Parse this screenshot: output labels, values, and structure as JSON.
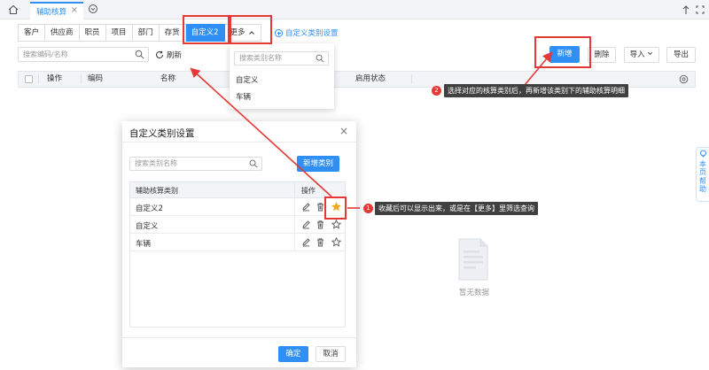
{
  "page_tab": {
    "label": "辅助核算"
  },
  "category_tabs": [
    {
      "label": "客户",
      "active": false
    },
    {
      "label": "供应商",
      "active": false
    },
    {
      "label": "职员",
      "active": false
    },
    {
      "label": "项目",
      "active": false
    },
    {
      "label": "部门",
      "active": false
    },
    {
      "label": "存货",
      "active": false
    },
    {
      "label": "自定义2",
      "active": true
    }
  ],
  "more_tab": {
    "label": "更多"
  },
  "custom_category_link": "自定义类别设置",
  "search": {
    "placeholder": "搜索编码/名称"
  },
  "refresh_label": "刷新",
  "toolbar": {
    "new": "新增",
    "delete": "删除",
    "import": "导入",
    "export": "导出"
  },
  "table": {
    "columns": [
      "操作",
      "编码",
      "名称",
      "启用状态"
    ]
  },
  "empty_text": "暂无数据",
  "help_tab": [
    "本",
    "页",
    "帮",
    "助"
  ],
  "more_dropdown": {
    "search_placeholder": "搜索类别名称",
    "items": [
      "自定义",
      "车辆"
    ]
  },
  "modal": {
    "title": "自定义类别设置",
    "search_placeholder": "搜索类别名称",
    "add_button": "新增类别",
    "columns": [
      "辅助核算类别",
      "操作"
    ],
    "rows": [
      {
        "name": "自定义2",
        "favorited": true
      },
      {
        "name": "自定义",
        "favorited": false
      },
      {
        "name": "车辆",
        "favorited": false
      }
    ],
    "confirm": "确定",
    "cancel": "取消"
  },
  "annotations": [
    {
      "number": "1",
      "text": "收藏后可以显示出来，或是在【更多】里筛选查询"
    },
    {
      "number": "2",
      "text": "选择对应的核算类别后，再新增该类别下的辅助核算明细"
    }
  ],
  "colors": {
    "primary": "#2f8ff5",
    "annotation": "#e53935",
    "tooltip_bg": "#404040",
    "favorite_star": "#f5a623"
  }
}
